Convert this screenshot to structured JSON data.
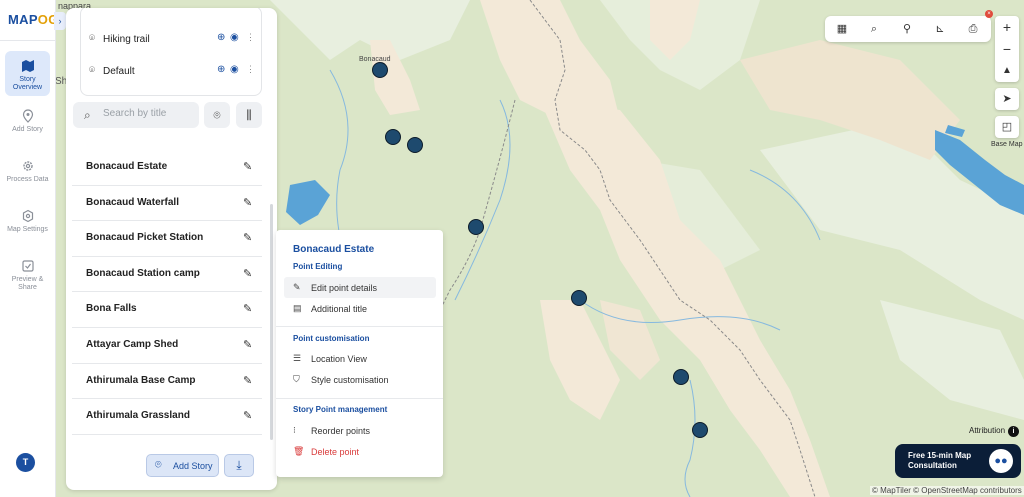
{
  "app": {
    "logo_main": "MAP",
    "logo_accent": "OG",
    "collapse_glyph": "›"
  },
  "map": {
    "place_label_top": "nappara",
    "place_label_pin": "Bonacaud",
    "edge_label": "Sh",
    "markers": [
      {
        "name": "marker-1"
      },
      {
        "name": "marker-2"
      },
      {
        "name": "marker-3"
      },
      {
        "name": "marker-4"
      },
      {
        "name": "marker-5"
      },
      {
        "name": "marker-6"
      },
      {
        "name": "marker-7"
      }
    ]
  },
  "rail": {
    "items": [
      {
        "label": "Story Overview",
        "icon": "map-icon"
      },
      {
        "label": "Add Story",
        "icon": "location-pin-icon"
      },
      {
        "label": "Process Data",
        "icon": "gear-icon"
      },
      {
        "label": "Map Settings",
        "icon": "settings-icon"
      },
      {
        "label": "Preview & Share",
        "icon": "preview-icon"
      }
    ],
    "avatar_initial": "T"
  },
  "layers": [
    {
      "label": "Hiking trail"
    },
    {
      "label": "Default"
    }
  ],
  "search": {
    "placeholder": "Search by title"
  },
  "stories": [
    "Bonacaud Estate",
    "Bonacaud Waterfall",
    "Bonacaud Picket Station",
    "Bonacaud Station camp",
    "Bona Falls",
    "Attayar Camp Shed",
    "Athirumala Base Camp",
    "Athirumala Grassland"
  ],
  "footer": {
    "add_story_label": "Add Story"
  },
  "context_menu": {
    "title": "Bonacaud Estate",
    "section_editing": "Point Editing",
    "edit_details": "Edit point details",
    "additional_title": "Additional title",
    "section_customisation": "Point customisation",
    "location_view": "Location View",
    "style_customisation": "Style customisation",
    "section_management": "Story Point management",
    "reorder_points": "Reorder points",
    "delete_point": "Delete point"
  },
  "right_controls": {
    "zoom_in": "+",
    "zoom_out": "−",
    "base_map_label": "Base Map",
    "attribution_label": "Attribution"
  },
  "consultation": {
    "line1": "Free 15-min Map",
    "line2": "Consultation"
  },
  "credits": "© MapTiler © OpenStreetMap contributors",
  "colors": {
    "brand": "#1b4fa0",
    "accent": "#e3a008",
    "danger": "#d93b3b",
    "marker": "#1e4a6e",
    "consult_bg": "#0b1e38"
  }
}
